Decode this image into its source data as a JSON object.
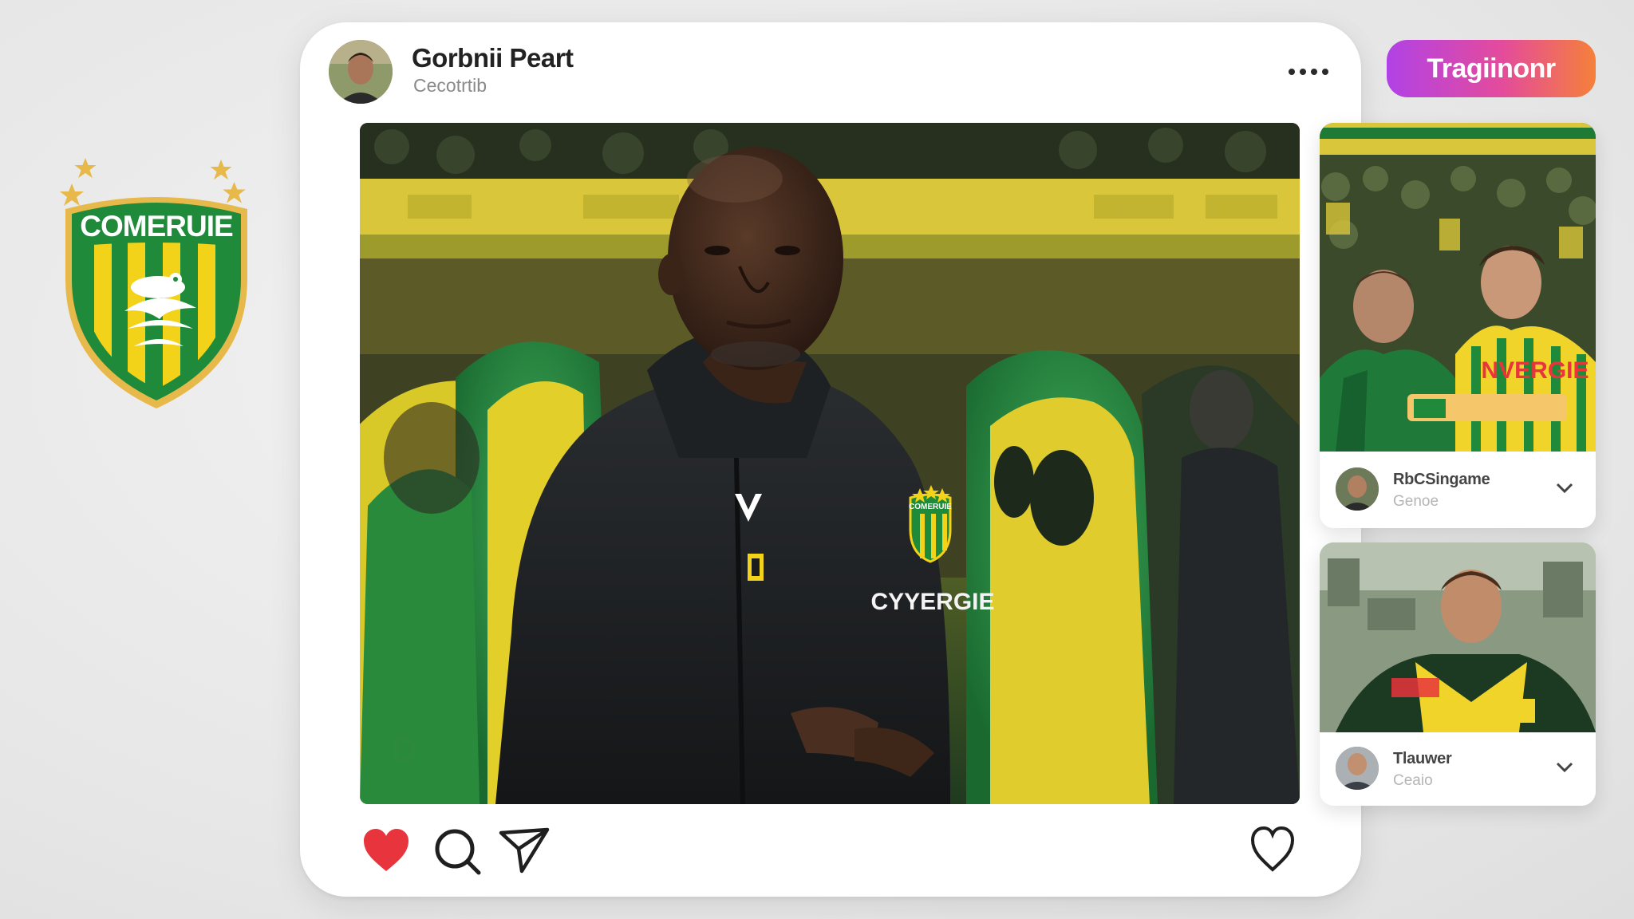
{
  "crest": {
    "name": "COMERUIE",
    "icon": "club-crest-icon",
    "colors": {
      "green": "#1e8a3a",
      "yellow": "#f3d21a",
      "gold": "#e6b94a"
    }
  },
  "post": {
    "author": "Gorbnii Peart",
    "subtitle": "Cecotrtib",
    "image": {
      "icon": "coach-photo",
      "crest_text": "COMERUIE",
      "sponsor_text": "CYYERGIE",
      "number_text": "D"
    },
    "actions": {
      "like_icon": "heart-filled-icon",
      "comment_icon": "comment-icon",
      "share_icon": "send-icon",
      "save_icon": "heart-outline-icon"
    },
    "liked": true,
    "accent_color": "#e8343c"
  },
  "badge": {
    "label": "Tragiinonr"
  },
  "suggestions": [
    {
      "image_text": "NVERGIE",
      "name": "RbCSingame",
      "subtitle": "Genoe"
    },
    {
      "image_text": "",
      "name": "Tlauwer",
      "subtitle": "Ceaio"
    }
  ]
}
